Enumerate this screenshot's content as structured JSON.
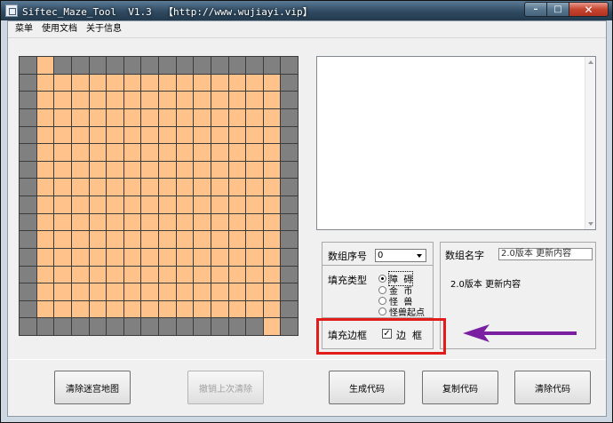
{
  "window": {
    "title": "Siftec_Maze_Tool  V1.3  【http://www.wujiayi.vip】",
    "controls": {
      "minimize": "–",
      "maximize": "□",
      "close": "✕"
    }
  },
  "menu": [
    "菜单",
    "使用文档",
    "关于信息"
  ],
  "maze": {
    "rows": 16,
    "cols": 16,
    "wall_color": "#808080",
    "path_color": "#ffc28a",
    "grid": [
      "1011111111111111",
      "1000000000000001",
      "1000000000000001",
      "1000000000000001",
      "1000000000000001",
      "1000000000000001",
      "1000000000000001",
      "1000000000000001",
      "1000000000000001",
      "1000000000000001",
      "1000000000000001",
      "1000000000000001",
      "1000000000000001",
      "1000000000000001",
      "1000000000000001",
      "1111111111111101"
    ]
  },
  "code_output": {
    "text": ""
  },
  "settings": {
    "array_index_label": "数组序号",
    "array_index_value": "0",
    "fill_type_label": "填充类型",
    "fill_types": [
      {
        "label": "障  碍",
        "selected": true
      },
      {
        "label": "金  币",
        "selected": false
      },
      {
        "label": "怪  兽",
        "selected": false
      },
      {
        "label": "怪兽起点",
        "selected": false
      }
    ],
    "fill_border_label": "填充边框",
    "border_checkbox_label": "边  框",
    "border_checked": true,
    "border_check_mark": "✓"
  },
  "array_name": {
    "label": "数组名字",
    "value": "2.0版本 更新内容",
    "display": "2.0版本 更新内容"
  },
  "buttons": {
    "clear_maze": "清除迷宫地图",
    "undo_clear": "撤销上次清除",
    "generate": "生成代码",
    "copy": "复制代码",
    "clear_code": "清除代码"
  },
  "colors": {
    "highlight": "#e21b1b",
    "arrow": "#7b1fa2"
  }
}
